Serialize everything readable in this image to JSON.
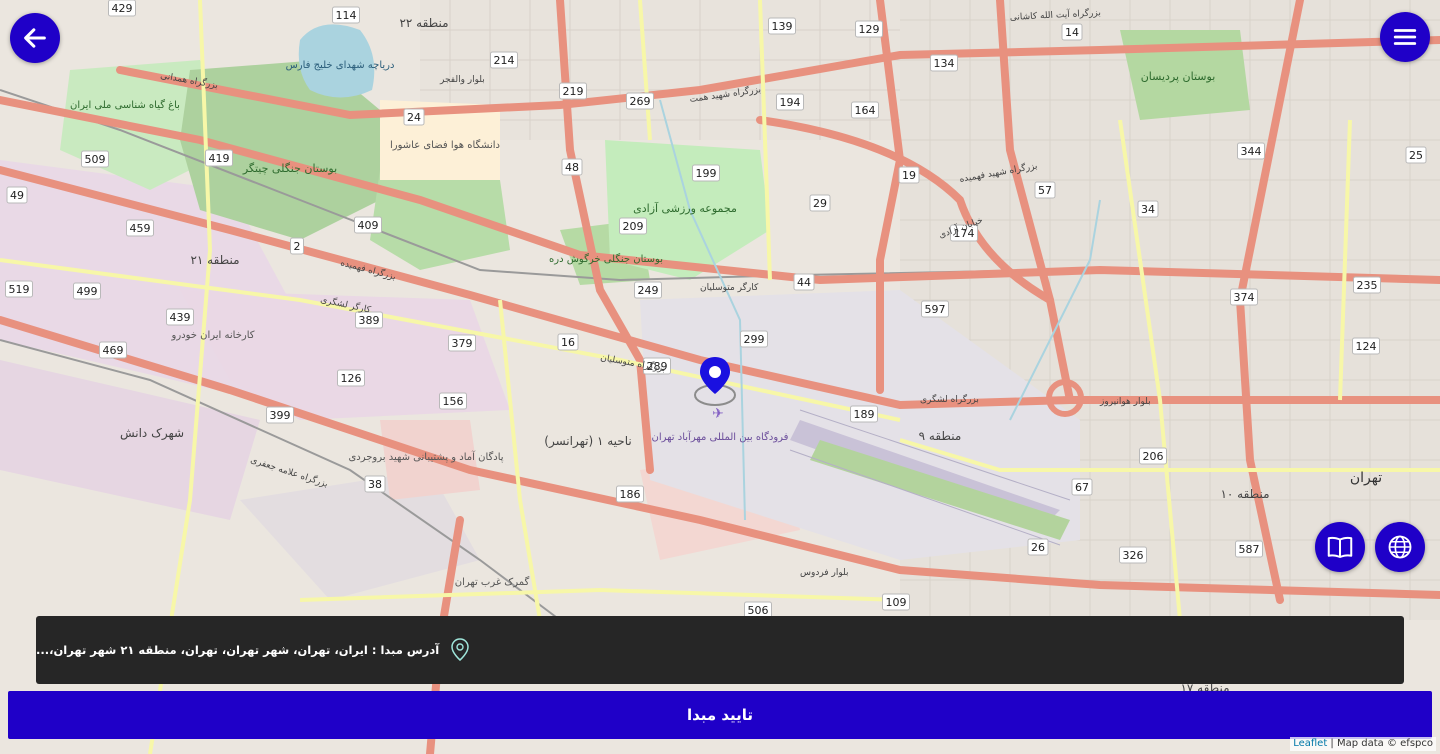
{
  "map": {
    "districts": [
      {
        "id": "d22",
        "text": "منطقه ۲۲"
      },
      {
        "id": "d21",
        "text": "منطقه ۲۱"
      },
      {
        "id": "d9",
        "text": "منطقه ۹"
      },
      {
        "id": "d10",
        "text": "منطقه ۱۰"
      },
      {
        "id": "d17",
        "text": "منطقه ۱۷"
      },
      {
        "id": "n1",
        "text": "ناحیه ۱ (تهرانسر)"
      },
      {
        "id": "shahrak",
        "text": "شهرک دانش"
      },
      {
        "id": "tehran",
        "text": "تهران"
      }
    ],
    "places": [
      {
        "id": "lake",
        "text": "دریاچه شهدای خلیج فارس"
      },
      {
        "id": "chitgar",
        "text": "بوستان جنگلی چیتگر"
      },
      {
        "id": "garden",
        "text": "باغ گیاه شناسی ملی ایران"
      },
      {
        "id": "univ",
        "text": "دانشگاه هوا فضای عاشورا"
      },
      {
        "id": "azadi",
        "text": "مجموعه ورزشی آزادی"
      },
      {
        "id": "kharghoosh",
        "text": "بوستان جنگلی خرگوش دره"
      },
      {
        "id": "khodro",
        "text": "کارخانه ایران خودرو"
      },
      {
        "id": "padegan",
        "text": "پادگان آماد و پشتیبانی شهید بروجردی"
      },
      {
        "id": "airport",
        "text": "فرودگاه بین المللی مهرآباد تهران"
      },
      {
        "id": "gomrok",
        "text": "گمرک غرب تهران"
      },
      {
        "id": "pardisan",
        "text": "بوستان پردیسان"
      }
    ],
    "streets": [
      {
        "id": "s1",
        "text": "بزرگراه همدانی"
      },
      {
        "id": "s2",
        "text": "بزرگراه فهمیده"
      },
      {
        "id": "s3",
        "text": "کارگر لشگری"
      },
      {
        "id": "s4",
        "text": "بزرگراه لشگری"
      },
      {
        "id": "s5",
        "text": "بزرگراه متوسلیان"
      },
      {
        "id": "s6",
        "text": "بزرگراه علامه جعفری"
      },
      {
        "id": "s7",
        "text": "بزرگراه شهید همت"
      },
      {
        "id": "s8",
        "text": "بزرگراه آیت الله کاشانی"
      },
      {
        "id": "s9",
        "text": "بزرگراه شهید فهمیده"
      },
      {
        "id": "s10",
        "text": "کارگر متوسلیان"
      },
      {
        "id": "s11",
        "text": "بلوار فردوس"
      },
      {
        "id": "s12",
        "text": "خیابان آزادی"
      },
      {
        "id": "s13",
        "text": "بلوار هوانیروز"
      },
      {
        "id": "s14",
        "text": "بلوار والفجر"
      }
    ],
    "road_numbers": [
      "429",
      "114",
      "214",
      "219",
      "269",
      "139",
      "129",
      "134",
      "194",
      "164",
      "14",
      "509",
      "419",
      "49",
      "409",
      "24",
      "48",
      "199",
      "209",
      "29",
      "19",
      "57",
      "174",
      "34",
      "344",
      "25",
      "459",
      "2",
      "519",
      "499",
      "439",
      "389",
      "379",
      "16",
      "249",
      "44",
      "597",
      "374",
      "235",
      "469",
      "126",
      "156",
      "289",
      "299",
      "189",
      "124",
      "399",
      "38",
      "186",
      "206",
      "67",
      "26",
      "326",
      "587",
      "506",
      "109"
    ]
  },
  "controls": {
    "back_icon": "arrow-left-icon",
    "menu_icon": "hamburger-menu-icon",
    "guide_icon": "open-book-icon",
    "globe_icon": "globe-icon"
  },
  "address": {
    "label": "آدرس مبدا :",
    "value": "ایران، تهران، شهر تهران، تهران، منطقه ۲۱ شهر تهران،..."
  },
  "confirm_label": "تایید مبدا",
  "attribution": {
    "leaflet": "Leaflet",
    "rest": " | Map data © efspco"
  },
  "colors": {
    "primary": "#1f00c8",
    "bar": "#262626",
    "marker": "#1a10e0"
  }
}
